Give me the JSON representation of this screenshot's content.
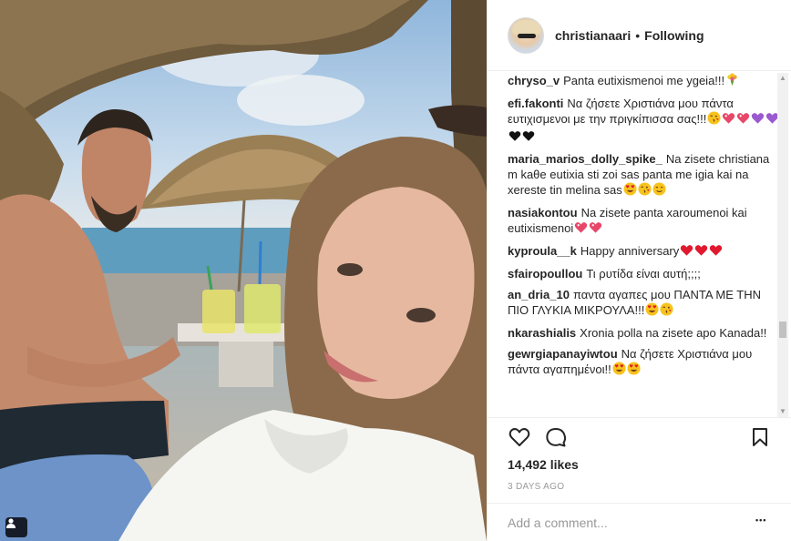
{
  "post": {
    "username": "christianaari",
    "separator": "•",
    "follow_status": "Following",
    "likes": "14,492 likes",
    "timestamp": "3 DAYS AGO",
    "add_comment_placeholder": "Add a comment...",
    "more_options": "•••"
  },
  "comments": [
    {
      "user": "chryso_v",
      "text": "Panta eutixismenoi me ygeia!!!",
      "emojis": [
        "bouquet"
      ]
    },
    {
      "user": "efi.fakonti",
      "text": "Να ζήσετε Χριστιάνα μου πάντα ευτιχισμενοι με την πριγκίπισσα σας!!!",
      "emojis": [
        "winking-kiss-face",
        "sparkling-heart",
        "sparkling-heart",
        "purple-heart",
        "purple-heart",
        "black-heart",
        "black-heart"
      ]
    },
    {
      "user": "maria_marios_dolly_spike_",
      "text": "Na zisete christiana m kaθe eutixia sti zoi sas panta me igia kai na xereste tin melina sas",
      "emojis": [
        "heart-eyes-face",
        "winking-kiss-face",
        "smiling-face"
      ]
    },
    {
      "user": "nasiakontou",
      "text": "Na zisete panta xaroumenoi kai eutixismenoi",
      "emojis": [
        "sparkling-heart",
        "sparkling-heart"
      ]
    },
    {
      "user": "kyproula__k",
      "text": "Happy anniversary",
      "emojis": [
        "red-heart",
        "red-heart",
        "red-heart"
      ]
    },
    {
      "user": "sfairopoullou",
      "text": "Τι ρυτίδα είναι αυτή;;;;",
      "emojis": []
    },
    {
      "user": "an_dria_10",
      "text": "παντα αγαπες μου ΠΑΝΤΑ ΜΕ ΤΗΝ ΠΙΟ ΓΛΥΚΙΑ ΜΙΚΡΟΥΛΑ!!!",
      "emojis": [
        "heart-eyes-face",
        "winking-kiss-face"
      ]
    },
    {
      "user": "nkarashialis",
      "text": "Xronia polla na zisete apo Kanada!!",
      "emojis": []
    },
    {
      "user": "gewrgiapanayiwtou",
      "text": "Να ζήσετε Χριστιάνα μου πάντα αγαπημένοι!!",
      "emojis": [
        "heart-eyes-face",
        "heart-eyes-face"
      ]
    }
  ],
  "icons": {
    "like": "heart-outline-icon",
    "comment": "speech-bubble-icon",
    "save": "bookmark-icon",
    "user_tag": "person-icon"
  },
  "colors": {
    "red_heart": "#e0192e",
    "purple_heart": "#9b59d0",
    "emoji_yellow": "#f7c21b",
    "text": "#262626",
    "muted": "#999999"
  }
}
